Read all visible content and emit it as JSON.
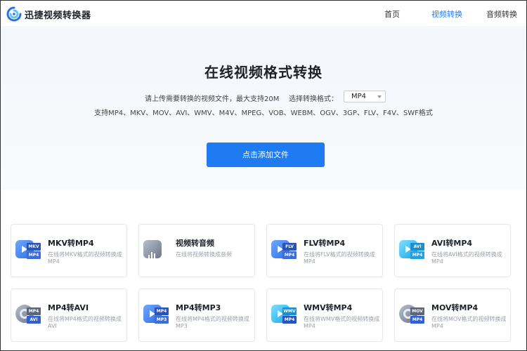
{
  "header": {
    "brand": "迅捷视频转换器",
    "nav": [
      {
        "label": "首页",
        "active": false
      },
      {
        "label": "视频转换",
        "active": true
      },
      {
        "label": "音频转换",
        "active": false
      }
    ]
  },
  "hero": {
    "title": "在线视频格式转换",
    "upload_hint": "请上传需要转换的视频文件，最大支持20M",
    "format_label": "选择转换格式：",
    "format_value": "MP4",
    "supported": "支持MP4、MKV、MOV、AVI、WMV、M4V、MPEG、VOB、WEBM、OGV、3GP、FLV、F4V、SWF格式",
    "upload_button": "点击添加文件"
  },
  "cards": [
    {
      "title": "MKV转MP4",
      "desc": "在线将MKV格式的视频转换成MP4",
      "icon": "mkv-to-mp4-icon",
      "tag_top": "MKV",
      "tag_bottom": "MP4"
    },
    {
      "title": "视频转音频",
      "desc": "在线将视频转换成音频",
      "icon": "video-to-audio-icon"
    },
    {
      "title": "FLV转MP4",
      "desc": "在线将FLV格式的视频转换成MP4",
      "icon": "flv-to-mp4-icon",
      "tag_top": "FLV",
      "tag_bottom": "MP4"
    },
    {
      "title": "AVI转MP4",
      "desc": "在线将AVI格式的视频转换成MP4",
      "icon": "avi-to-mp4-icon",
      "tag_top": "AVI",
      "tag_bottom": "MP4"
    },
    {
      "title": "MP4转AVI",
      "desc": "在线将MP4格式的视频转换成AVI",
      "icon": "mp4-to-avi-icon",
      "tag_top": "MP4",
      "tag_bottom": "AVI"
    },
    {
      "title": "MP4转MP3",
      "desc": "在线将MP4格式的视频转换成MP3",
      "icon": "mp4-to-mp3-icon",
      "tag_top": "MP4",
      "tag_bottom": "MP3"
    },
    {
      "title": "WMV转MP4",
      "desc": "在线将WMV格式的视频转换成MP4",
      "icon": "wmv-to-mp4-icon",
      "tag_top": "WMV",
      "tag_bottom": "MP4"
    },
    {
      "title": "MOV转MP4",
      "desc": "在线将MOV格式的视频转换成MP4",
      "icon": "mov-to-mp4-icon",
      "tag_top": "MOV",
      "tag_bottom": "MP4"
    }
  ],
  "colors": {
    "accent": "#1f7bf2",
    "hero_bg": "#f3f6fb"
  }
}
